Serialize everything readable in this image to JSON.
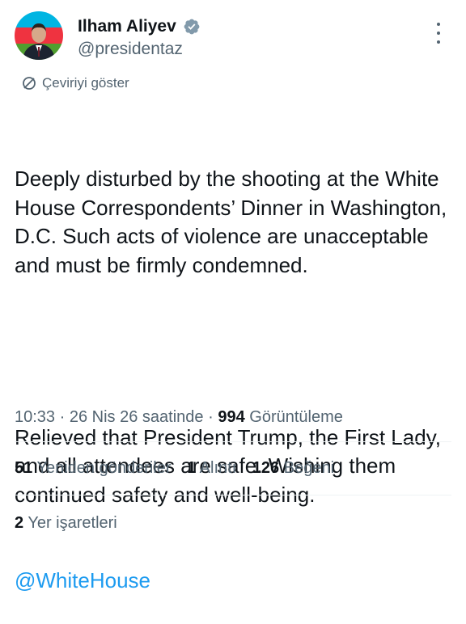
{
  "author": {
    "display_name": "Ilham Aliyev",
    "handle": "@presidentaz",
    "verified": true,
    "avatar_colors": [
      "#00b5e2",
      "#ef3340",
      "#509e2f"
    ]
  },
  "translate": {
    "label": "Çeviriyi göster"
  },
  "tweet": {
    "paragraph1": "Deeply disturbed by the shooting at the White House Correspondents’ Dinner in Washington, D.C. Such acts of violence are unacceptable and must be firmly condemned.",
    "paragraph2": "Relieved that President Trump, the First Lady, and all attendees are safe. Wishing them continued safety and well-being.",
    "mention": "@WhiteHouse"
  },
  "meta": {
    "time": "10:33",
    "date": "26 Nis 26 saatinde",
    "views_count": "994",
    "views_label": "Görüntüleme",
    "separator": "·"
  },
  "stats": {
    "retweets_count": "51",
    "retweets_label": "Yeniden gönderiler",
    "quotes_count": "1",
    "quotes_label": "Alıntı",
    "likes_count": "126",
    "likes_label": "Beğeni"
  },
  "bookmarks": {
    "count": "2",
    "label": "Yer işaretleri"
  },
  "colors": {
    "accent": "#1d9bf0",
    "secondary_text": "#536471",
    "primary_text": "#0f1419"
  }
}
